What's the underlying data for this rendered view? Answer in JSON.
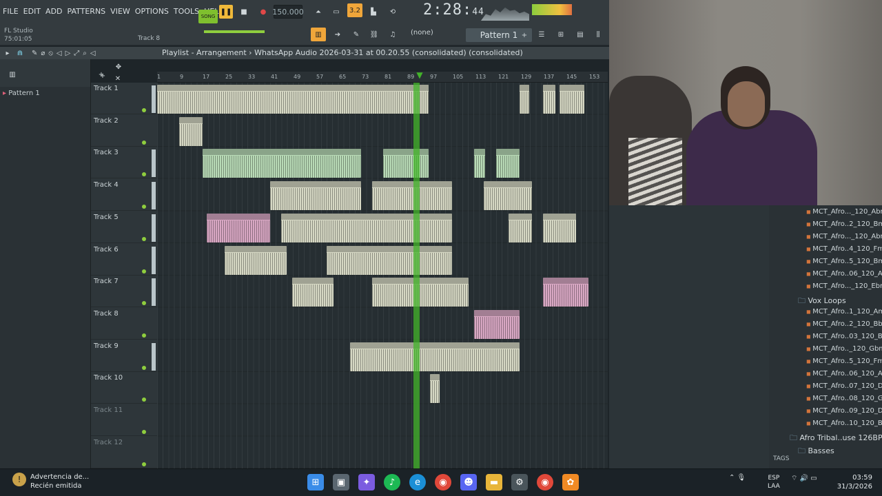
{
  "menu": [
    "FILE",
    "EDIT",
    "ADD",
    "PATTERNS",
    "VIEW",
    "OPTIONS",
    "TOOLS",
    "HELP"
  ],
  "app": {
    "name": "FL Studio",
    "hint_time": "75:01:05",
    "track_hint": "Track 8"
  },
  "transport": {
    "song_label": "SONG",
    "tempo": "150.000",
    "time": "2:28",
    "time_small": "44",
    "none_label": "(none)",
    "pattern": "Pattern 1"
  },
  "playlist": {
    "title": "Playlist - Arrangement",
    "file": "WhatsApp Audio 2026-03-31 at 00.20.55 (consolidated) (consolidated)"
  },
  "pattern_item": "Pattern 1",
  "ruler": [
    "1",
    "9",
    "17",
    "25",
    "33",
    "41",
    "49",
    "57",
    "65",
    "73",
    "81",
    "89",
    "97",
    "105",
    "113",
    "121",
    "129",
    "137",
    "145",
    "153"
  ],
  "tracks": [
    "Track 1",
    "Track 2",
    "Track 3",
    "Track 4",
    "Track 5",
    "Track 6",
    "Track 7",
    "Track 8",
    "Track 9",
    "Track 10",
    "Track 11",
    "Track 12"
  ],
  "library": [
    "MCT_Afro..._120_Abm",
    "MCT_Afro..2_120_Bm",
    "MCT_Afro..._120_Abm",
    "MCT_Afro..4_120_Fm",
    "MCT_Afro..5_120_Bm",
    "MCT_Afro..06_120_A",
    "MCT_Afro..._120_Ebm"
  ],
  "vox_folder": "Vox Loops",
  "vox_items": [
    "MCT_Afro..1_120_Am",
    "MCT_Afro..2_120_Bb",
    "MCT_Afro..03_120_B",
    "MCT_Afro.._120_Gbm",
    "MCT_Afro..5_120_Fm",
    "MCT_Afro..06_120_A",
    "MCT_Afro..07_120_D",
    "MCT_Afro..08_120_G",
    "MCT_Afro..09_120_D",
    "MCT_Afro..10_120_B"
  ],
  "afro_folder": "Afro Tribal..use 126BPM",
  "basses_folder": "Basses",
  "tags_label": "TAGS",
  "notification": {
    "title": "Advertencia de...",
    "subtitle": "Recién emitida"
  },
  "taskbar": {
    "lang1": "ESP",
    "lang2": "LAA",
    "time": "03:59",
    "date": "31/3/2026"
  }
}
